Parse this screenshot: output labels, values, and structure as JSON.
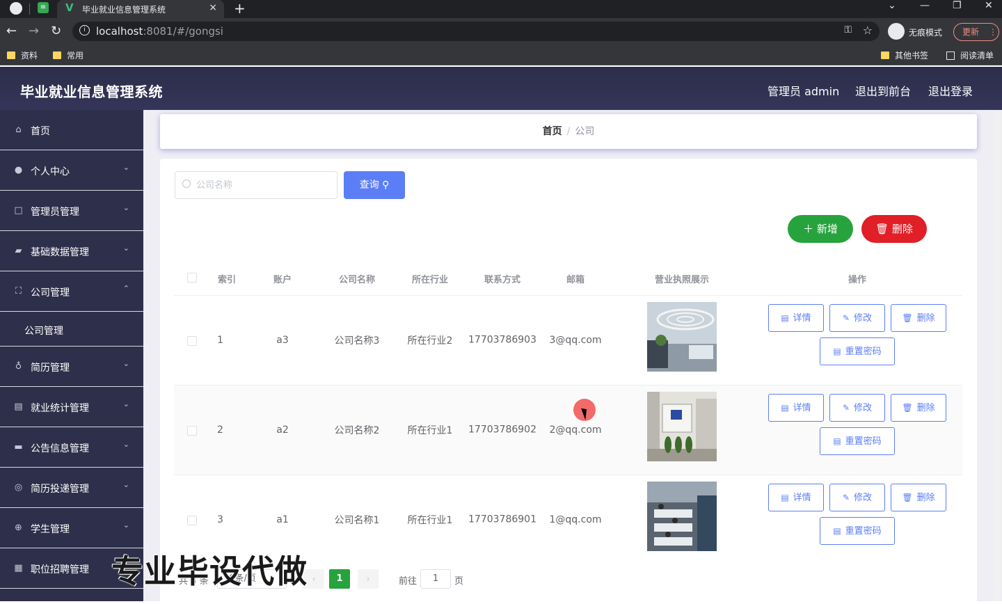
{
  "browser": {
    "tab_title": "毕业就业信息管理系统",
    "tab_close": "×",
    "new_tab": "+",
    "url_host": "localhost",
    "url_rest": ":8081/#/gongsi",
    "incognito_label": "无痕模式",
    "update_label": "更新",
    "bookmarks": [
      "资料",
      "常用"
    ],
    "other_bookmarks": "其他书签",
    "reading_list": "阅读清单"
  },
  "header": {
    "title": "毕业就业信息管理系统",
    "user": "管理员 admin",
    "back_front": "退出到前台",
    "logout": "退出登录"
  },
  "sidebar": {
    "items": [
      {
        "label": "首页",
        "icon": "home-icon",
        "arrow": ""
      },
      {
        "label": "个人中心",
        "icon": "user-icon",
        "arrow": "⌄"
      },
      {
        "label": "管理员管理",
        "icon": "frame-icon",
        "arrow": "⌄"
      },
      {
        "label": "基础数据管理",
        "icon": "suitcase-icon",
        "arrow": "⌄"
      },
      {
        "label": "公司管理",
        "icon": "fullscreen-icon",
        "arrow": "⌃"
      },
      {
        "label": "简历管理",
        "icon": "microphone-icon",
        "arrow": "⌄"
      },
      {
        "label": "就业统计管理",
        "icon": "document-icon",
        "arrow": "⌄"
      },
      {
        "label": "公告信息管理",
        "icon": "briefcase-icon",
        "arrow": "⌄"
      },
      {
        "label": "简历投递管理",
        "icon": "globe-icon",
        "arrow": "⌄"
      },
      {
        "label": "学生管理",
        "icon": "compass-icon",
        "arrow": "⌄"
      },
      {
        "label": "职位招聘管理",
        "icon": "file-icon",
        "arrow": "⌄"
      }
    ],
    "sub_item": "公司管理"
  },
  "breadcrumb": {
    "home": "首页",
    "sep": "/",
    "current": "公司"
  },
  "search": {
    "placeholder": "公司名称",
    "button": "查询"
  },
  "actions": {
    "add": "新增",
    "delete": "删除"
  },
  "table": {
    "headers": [
      "索引",
      "账户",
      "公司名称",
      "所在行业",
      "联系方式",
      "邮箱",
      "营业执照展示",
      "操作"
    ],
    "rows": [
      {
        "index": "1",
        "account": "a3",
        "name": "公司名称3",
        "industry": "所在行业2",
        "phone": "17703786903",
        "email": "3@qq.com",
        "image": "office-lobby"
      },
      {
        "index": "2",
        "account": "a2",
        "name": "公司名称2",
        "industry": "所在行业1",
        "phone": "17703786902",
        "email": "2@qq.com",
        "image": "office-reception"
      },
      {
        "index": "3",
        "account": "a1",
        "name": "公司名称1",
        "industry": "所在行业1",
        "phone": "17703786901",
        "email": "1@qq.com",
        "image": "office-workspace"
      }
    ],
    "ops": {
      "detail": "详情",
      "edit": "修改",
      "delete": "删除",
      "reset": "重置密码"
    }
  },
  "pagination": {
    "total": "共 3 条",
    "size": "10条/页",
    "current": "1",
    "goto": "前往",
    "goto_value": "1",
    "unit": "页"
  },
  "watermark": "专业毕设代做",
  "colors": {
    "primary": "#5b7ef6",
    "success": "#27a33d",
    "danger": "#e01f26",
    "sidebar": "#2e2f4a"
  }
}
